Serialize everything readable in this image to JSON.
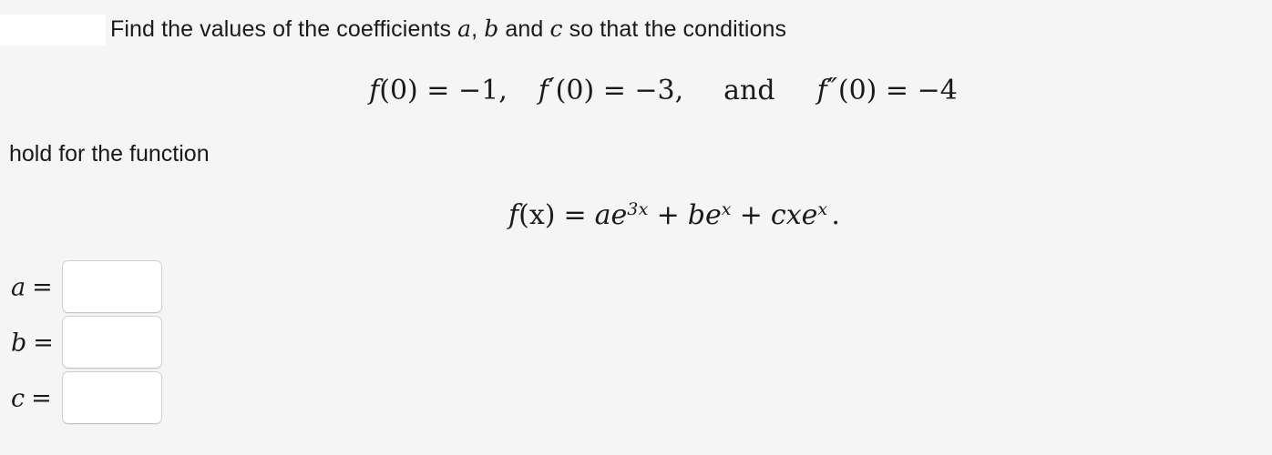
{
  "page": {
    "background_color": "#f5f5f5",
    "text_color": "#1a1a1a"
  },
  "prompt": {
    "part1": "Find the values of the coefficients ",
    "var_a": "a",
    "sep1": ", ",
    "var_b": "b",
    "sep2": " and ",
    "var_c": "c",
    "part2": " so that the conditions"
  },
  "conditions": {
    "cond1": {
      "fn": "f",
      "arg": "(0)",
      "relation": " = ",
      "value": "−1,"
    },
    "cond2": {
      "fn": "f",
      "prime": "′",
      "arg": "(0)",
      "relation": " = ",
      "value": "−3,"
    },
    "conjunction": "and",
    "cond3": {
      "fn": "f",
      "prime": "″",
      "arg": "(0)",
      "relation": " = ",
      "value": "−4"
    }
  },
  "hold_line": "hold for the function",
  "function": {
    "lhs_fn": "f",
    "lhs_arg": "(x)",
    "equals": "=",
    "term1_coeff": "ae",
    "term1_exp": "3x",
    "plus1": "+",
    "term2_coeff": "be",
    "term2_exp": "x",
    "plus2": "+",
    "term3_coeff": "cxe",
    "term3_exp": "x",
    "period": "."
  },
  "answers": {
    "rows": [
      {
        "label": "a",
        "equals": "=",
        "value": "",
        "placeholder": ""
      },
      {
        "label": "b",
        "equals": "=",
        "value": "",
        "placeholder": ""
      },
      {
        "label": "c",
        "equals": "=",
        "value": "",
        "placeholder": ""
      }
    ]
  }
}
